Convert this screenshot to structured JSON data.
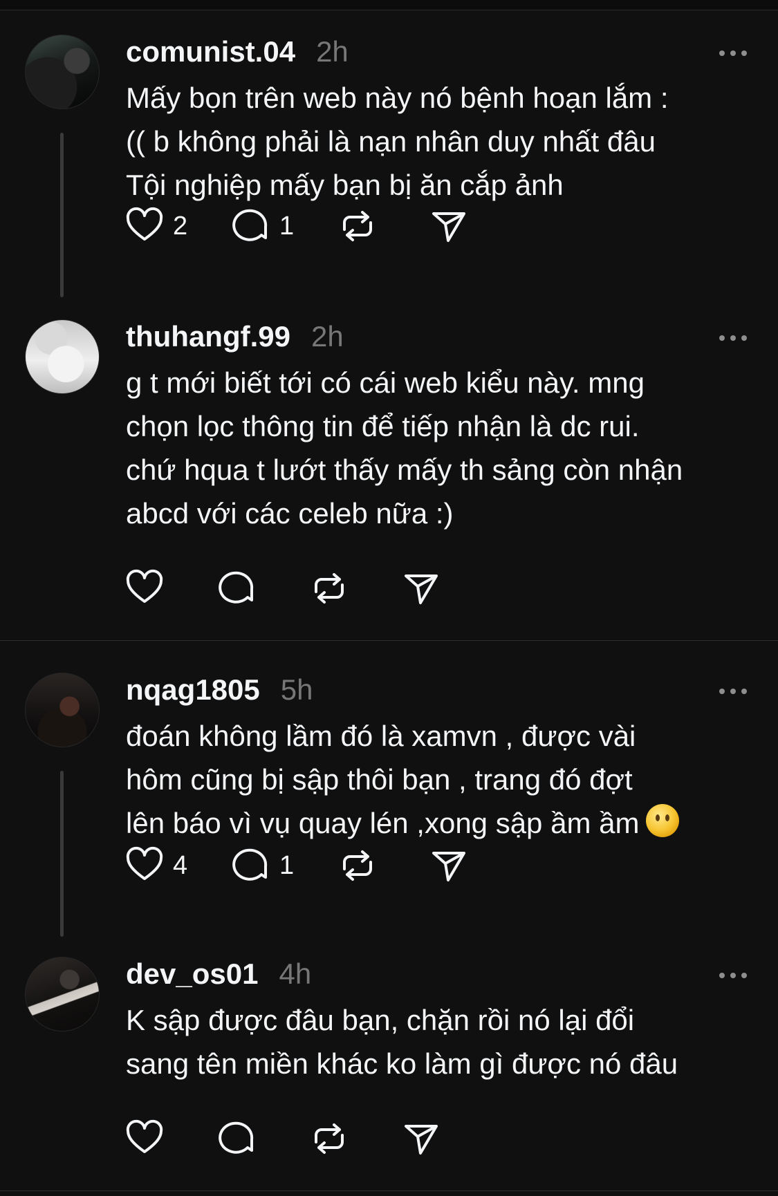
{
  "posts": [
    {
      "username": "comunist.04",
      "time": "2h",
      "text": "Mấy bọn trên web này nó bệnh hoạn lắm :\n(( b không phải là nạn nhân duy nhất đâu\nTội nghiệp mấy bạn bị ăn cắp ảnh",
      "likes": "2",
      "replies": "1"
    },
    {
      "username": "thuhangf.99",
      "time": "2h",
      "text": "g t mới biết tới có cái web kiểu này. mng\nchọn lọc thông tin để tiếp nhận là dc rui.\nchứ hqua t lướt thấy mấy th sảng còn nhận\nabcd với các celeb nữa :)",
      "likes": "",
      "replies": ""
    },
    {
      "username": "nqag1805",
      "time": "5h",
      "text": "đoán không lầm đó là xamvn , được vài\nhôm cũng bị sập thôi bạn , trang đó đợt\nlên báo vì vụ quay lén ,xong sập ầm ầm",
      "emoji": "face-without-mouth-emoji",
      "likes": "4",
      "replies": "1"
    },
    {
      "username": "dev_os01",
      "time": "4h",
      "text": "K sập được đâu bạn, chặn rồi nó lại đổi\nsang tên miền khác ko làm gì được nó đâu",
      "likes": "",
      "replies": ""
    }
  ],
  "icons": {
    "like": "heart-icon",
    "reply": "comment-bubble-icon",
    "repost": "repost-icon",
    "share": "send-icon",
    "more": "more-dots-icon"
  },
  "colors": {
    "background": "#101010",
    "text": "#f3f5f7",
    "muted": "#777777",
    "divider": "#2f2f2f"
  }
}
